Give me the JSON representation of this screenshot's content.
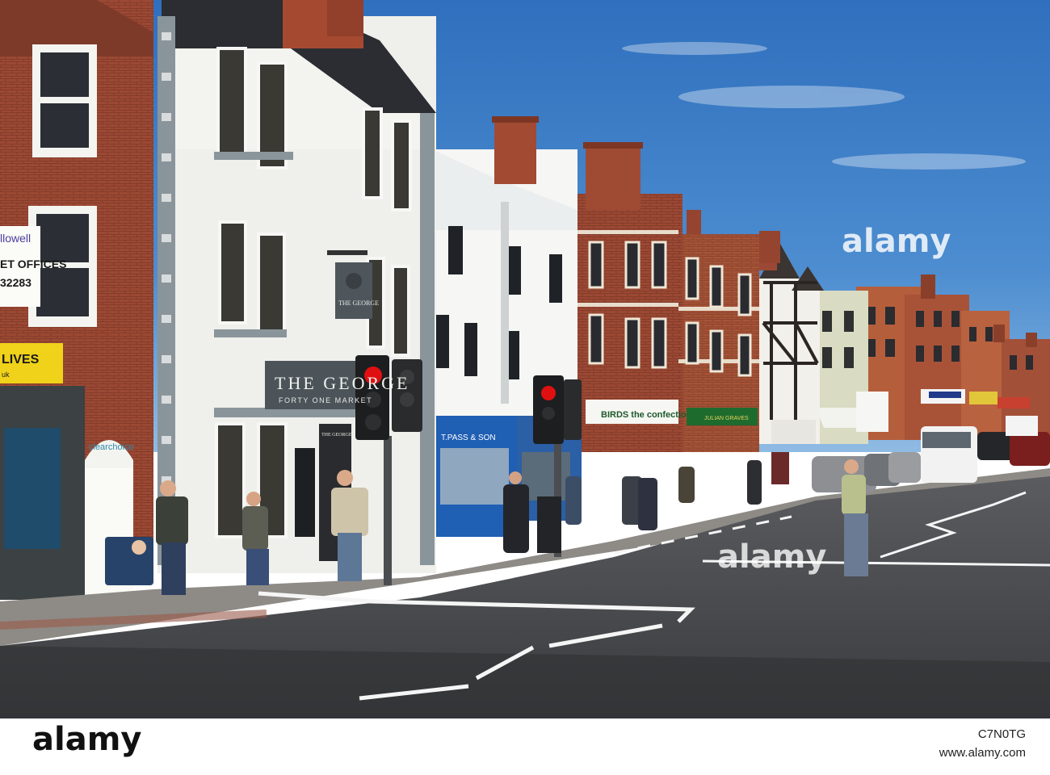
{
  "signs": {
    "pub_name": "THE GEORGE",
    "pub_tagline": "FORTY ONE MARKET",
    "pub_hanging": "THE GEORGE",
    "pub_door": "THE GEORGE",
    "pass_son": "T.PASS & SON",
    "birds": "BIRDS the confectioners",
    "estate_name": "llowell",
    "estate_line": "ET OFFICES",
    "estate_phone": "32283",
    "lives": "LIVES",
    "lives_sub": "uk",
    "clearchoice": "clearchoice",
    "julian": "JULIAN GRAVES"
  },
  "watermark": {
    "top_text": "alamy",
    "mid_text": "alamy",
    "footer_logo": "alamy",
    "image_id": "C7N0TG",
    "url": "www.alamy.com"
  },
  "colors": {
    "sky": "#3f7fc6",
    "road": "#4a4b4f",
    "brick": "#9a4a34",
    "white_building": "#eeeeea",
    "pass_son_blue": "#1f5fb4",
    "signal_red": "#e01010"
  }
}
